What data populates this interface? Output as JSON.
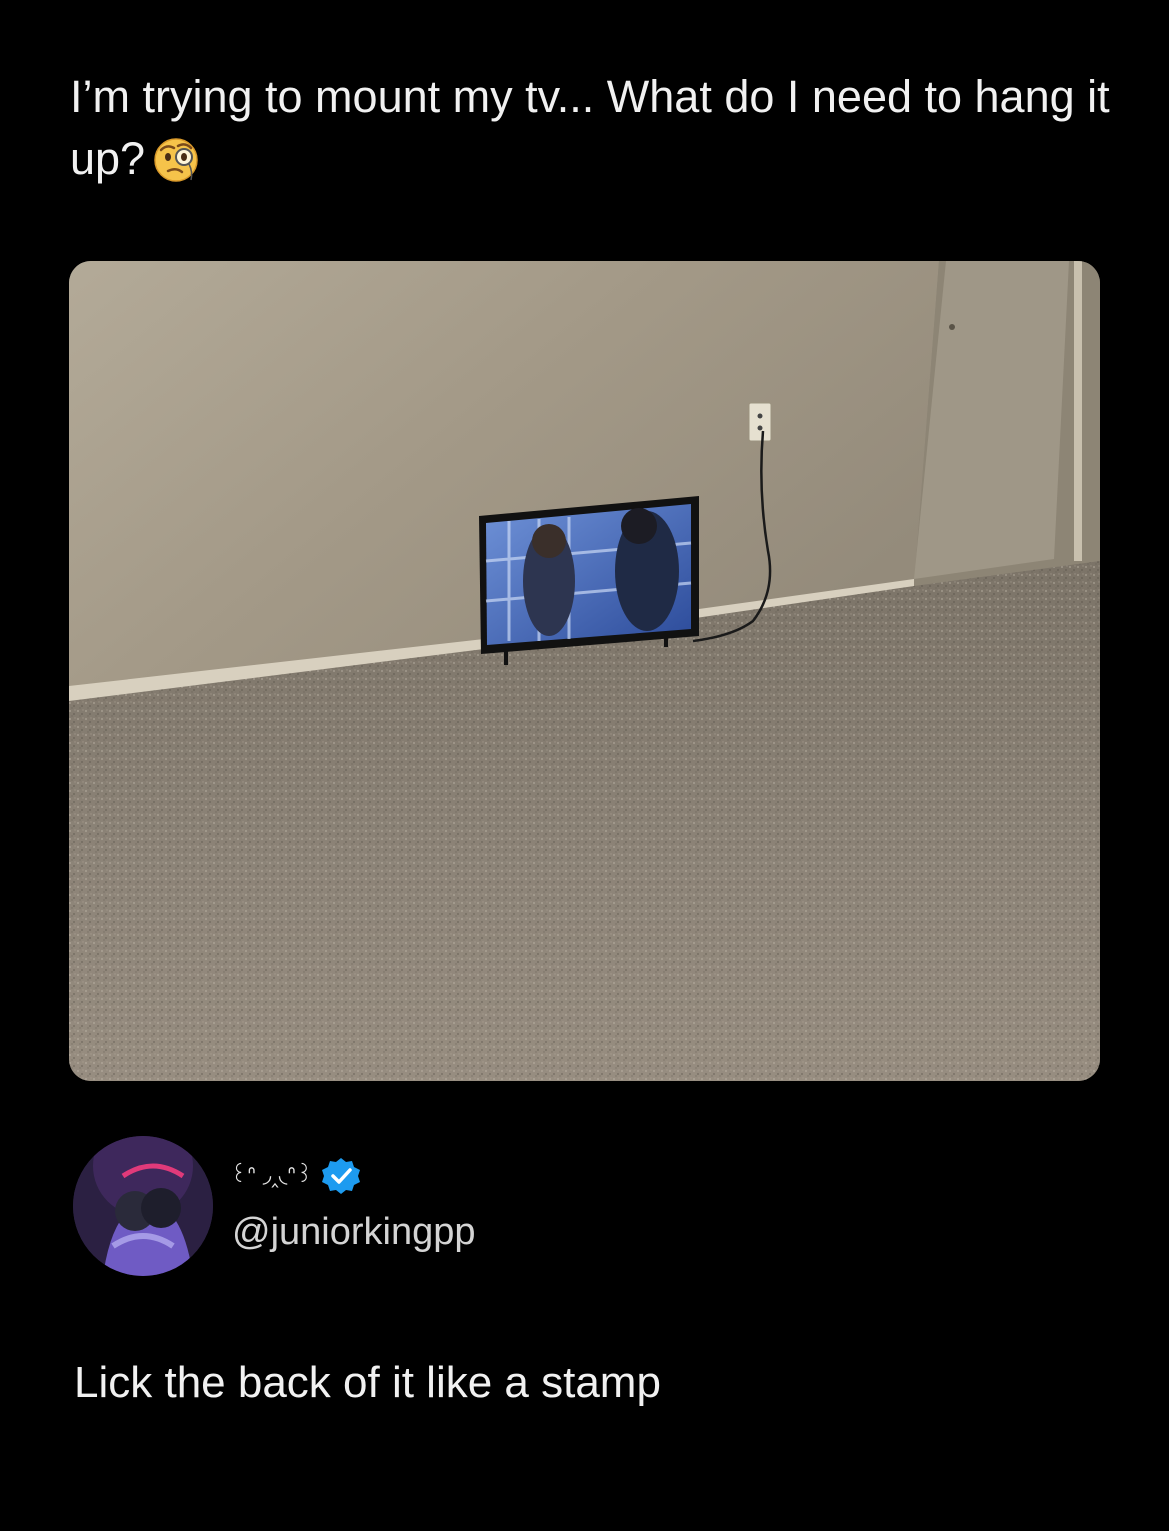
{
  "post": {
    "text": "I’m trying to mount my tv... What do I need to hang it up?",
    "emoji": "face-with-monocle-icon"
  },
  "media": {
    "description_icon": "photo-tv-on-floor"
  },
  "reply": {
    "display_name": "꒰ᐢ ◞‸◟ᐢ꒱",
    "verified_icon": "verified-badge-icon",
    "handle": "@juniorkingpp",
    "text": "Lick the back of it like a stamp"
  },
  "colors": {
    "background": "#000000",
    "text": "#f1f1f1",
    "verified": "#1d9bf0"
  }
}
